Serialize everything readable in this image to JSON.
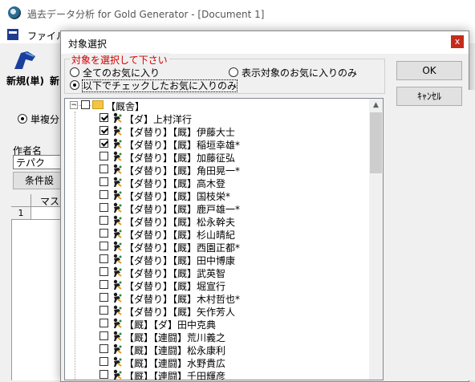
{
  "main_window": {
    "title": "過去データ分析 for Gold Generator - [Document 1]",
    "menu_file": "ファイル(",
    "toolbar_new_label": "新規(単)",
    "toolbar_second_label": "新",
    "radio_single": "単複分",
    "author_label": "作者名",
    "author_value": "テパク",
    "conditions_button": "条件設",
    "grid_header": "マス",
    "grid_row_number": "1"
  },
  "dialog": {
    "title": "対象選択",
    "close_label": "x",
    "group_title": "対象を選択して下さい",
    "options": [
      {
        "label": "全てのお気に入り",
        "selected": false
      },
      {
        "label": "表示対象のお気に入りのみ",
        "selected": false
      },
      {
        "label": "以下でチェックしたお気に入りのみ",
        "selected": true
      }
    ],
    "ok_label": "OK",
    "cancel_label": "ｷｬﾝｾﾙ",
    "tree": {
      "root_label": "【厩舎】",
      "items": [
        {
          "label": "【ダ】上村洋行",
          "checked": true
        },
        {
          "label": "【ダ替り】【厩】伊藤大士",
          "checked": true
        },
        {
          "label": "【ダ替り】【厩】稲垣幸雄*",
          "checked": true
        },
        {
          "label": "【ダ替り】【厩】加藤征弘",
          "checked": false
        },
        {
          "label": "【ダ替り】【厩】角田晃一*",
          "checked": false
        },
        {
          "label": "【ダ替り】【厩】高木登",
          "checked": false
        },
        {
          "label": "【ダ替り】【厩】国枝栄*",
          "checked": false
        },
        {
          "label": "【ダ替り】【厩】鹿戸雄一*",
          "checked": false
        },
        {
          "label": "【ダ替り】【厩】松永幹夫",
          "checked": false
        },
        {
          "label": "【ダ替り】【厩】杉山晴紀",
          "checked": false
        },
        {
          "label": "【ダ替り】【厩】西園正都*",
          "checked": false
        },
        {
          "label": "【ダ替り】【厩】田中博康",
          "checked": false
        },
        {
          "label": "【ダ替り】【厩】武英智",
          "checked": false
        },
        {
          "label": "【ダ替り】【厩】堀宣行",
          "checked": false
        },
        {
          "label": "【ダ替り】【厩】木村哲也*",
          "checked": false
        },
        {
          "label": "【ダ替り】【厩】矢作芳人",
          "checked": false
        },
        {
          "label": "【厩】【ダ】田中克典",
          "checked": false
        },
        {
          "label": "【厩】【連闘】荒川義之",
          "checked": false
        },
        {
          "label": "【厩】【連闘】松永康利",
          "checked": false
        },
        {
          "label": "【厩】【連闘】水野貴広",
          "checked": false
        },
        {
          "label": "【厩】【連闘】千田輝彦",
          "checked": false
        }
      ]
    }
  }
}
